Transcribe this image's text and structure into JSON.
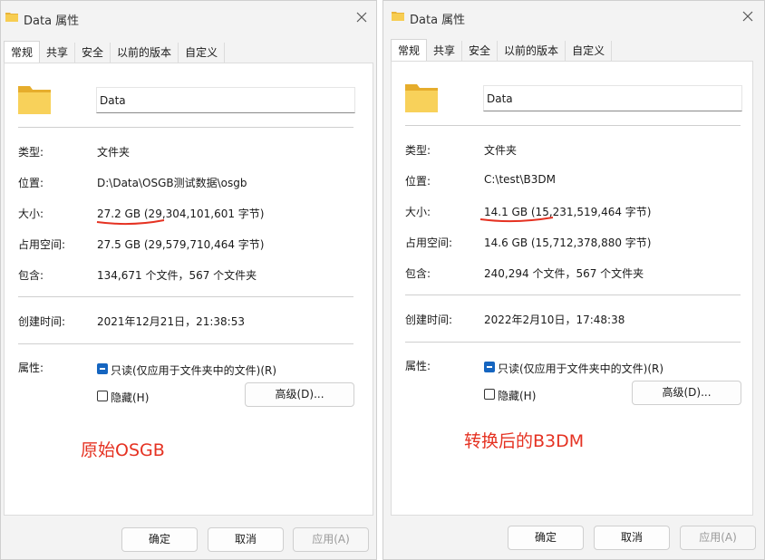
{
  "left": {
    "title": "Data 属性",
    "tabs": [
      "常规",
      "共享",
      "安全",
      "以前的版本",
      "自定义"
    ],
    "name_value": "Data",
    "rows": {
      "type_label": "类型:",
      "type_value": "文件夹",
      "location_label": "位置:",
      "location_value": "D:\\Data\\OSGB测试数据\\osgb",
      "size_label": "大小:",
      "size_value": "27.2 GB (29,304,101,601 字节)",
      "disk_label": "占用空间:",
      "disk_value": "27.5 GB (29,579,710,464 字节)",
      "contains_label": "包含:",
      "contains_value": "134,671 个文件，567 个文件夹",
      "created_label": "创建时间:",
      "created_value": "2021年12月21日，21:38:53",
      "attr_label": "属性:"
    },
    "readonly_label": "只读(仅应用于文件夹中的文件)(R)",
    "hidden_label": "隐藏(H)",
    "advanced_label": "高级(D)...",
    "annotation": "原始OSGB",
    "ok_label": "确定",
    "cancel_label": "取消",
    "apply_label": "应用(A)"
  },
  "right": {
    "title": "Data 属性",
    "tabs": [
      "常规",
      "共享",
      "安全",
      "以前的版本",
      "自定义"
    ],
    "name_value": "Data",
    "rows": {
      "type_label": "类型:",
      "type_value": "文件夹",
      "location_label": "位置:",
      "location_value": "C:\\test\\B3DM",
      "size_label": "大小:",
      "size_value": "14.1 GB (15,231,519,464 字节)",
      "disk_label": "占用空间:",
      "disk_value": "14.6 GB (15,712,378,880 字节)",
      "contains_label": "包含:",
      "contains_value": "240,294 个文件，567 个文件夹",
      "created_label": "创建时间:",
      "created_value": "2022年2月10日，17:48:38",
      "attr_label": "属性:"
    },
    "readonly_label": "只读(仅应用于文件夹中的文件)(R)",
    "hidden_label": "隐藏(H)",
    "advanced_label": "高级(D)...",
    "annotation": "转换后的B3DM",
    "ok_label": "确定",
    "cancel_label": "取消",
    "apply_label": "应用(A)"
  },
  "colors": {
    "accent": "#1565c0",
    "annotation": "#e53222",
    "folder": "#f5c94a"
  }
}
